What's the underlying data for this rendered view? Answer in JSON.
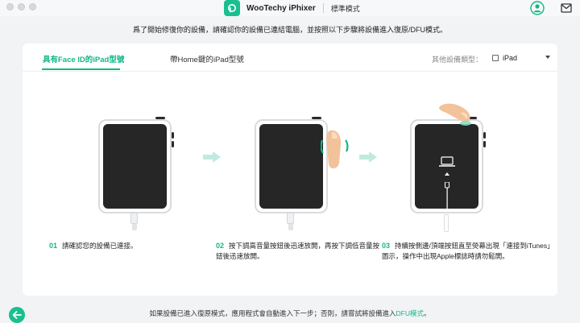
{
  "app": {
    "name": "WooTechy iPhixer",
    "mode": "標準模式"
  },
  "instruction": "爲了開始修復你的設備，請確認你的設備已連結電腦，並按照以下步驟將設備進入復原/DFU模式。",
  "tabs": [
    {
      "label": "具有Face ID的iPad型號",
      "active": true
    },
    {
      "label": "帶Home鍵的iPad型號",
      "active": false
    }
  ],
  "device_type": {
    "label": "其他設備類型：",
    "option": "iPad",
    "checked": false
  },
  "steps": [
    {
      "num": "01",
      "text": "請確認您的設備已連接。"
    },
    {
      "num": "02",
      "text": "按下調高音量按鈕後迅速放開，再按下調低音量按鈕後迅速放開。"
    },
    {
      "num": "03",
      "text": "持續按側邊/頂端按鈕直至熒幕出現「連接到iTunes」圖示，操作中出現Apple標誌時請勿鬆開。"
    }
  ],
  "footer": {
    "text": "如果設備已進入復原模式，應用程式會自動進入下一步；否則，請嘗試將設備進入",
    "link": "DFU模式",
    "suffix": "。"
  },
  "colors": {
    "accent": "#12b886",
    "screen": "#262626",
    "background": "#f1f3f5"
  },
  "icons": [
    "app-logo-icon",
    "user-icon",
    "mail-icon",
    "back-arrow-icon",
    "laptop-icon",
    "lightning-cable-icon",
    "arrow-right-icon",
    "finger-icon"
  ]
}
